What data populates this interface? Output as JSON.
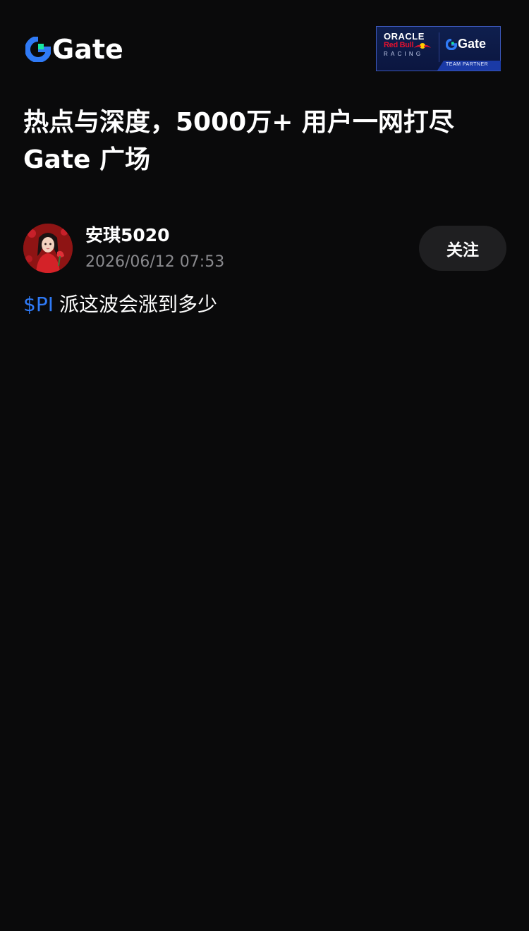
{
  "header": {
    "logo": {
      "icon": "gate-logo-icon",
      "text": "Gate",
      "accent_color": "#2f7af6",
      "secondary_color": "#17e6a1"
    },
    "partner_badge": {
      "oracle": "ORACLE",
      "red_bull": "Red Bull",
      "racing": "RACING",
      "gate": "Gate",
      "team_partner": "TEAM PARTNER"
    }
  },
  "headline": {
    "line1": "热点与深度，5000万+ 用户一网打尽",
    "line2": "Gate 广场"
  },
  "post": {
    "author": "安琪5020",
    "timestamp": "2026/06/12 07:53",
    "follow_label": "关注",
    "ticker": "$PI",
    "text": "派这波会涨到多少",
    "ticker_color": "#2f7af6"
  }
}
